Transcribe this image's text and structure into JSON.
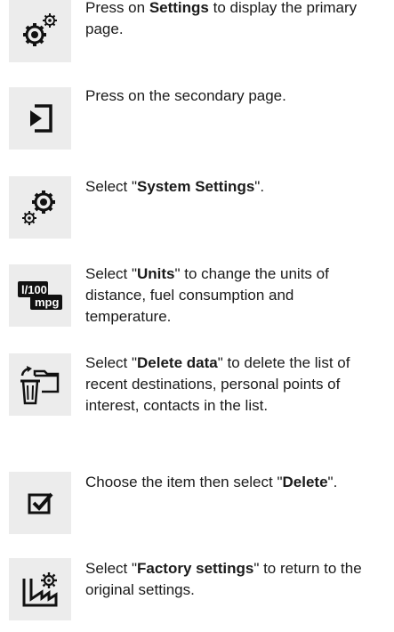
{
  "steps": [
    {
      "icon": "settings-gears-icon",
      "before": "Press on ",
      "bold": "Settings",
      "after": " to display the primary page."
    },
    {
      "icon": "secondary-page-icon",
      "before": "Press on the secondary page.",
      "bold": "",
      "after": ""
    },
    {
      "icon": "system-settings-icon",
      "before": "Select \"",
      "bold": "System Settings",
      "after": "\"."
    },
    {
      "icon": "units-icon",
      "icon_text_top": "l/100",
      "icon_text_bottom": "mpg",
      "before": "Select \"",
      "bold": "Units",
      "after": "\" to change the units of distance, fuel consumption and temperature."
    },
    {
      "icon": "delete-data-icon",
      "before": "Select \"",
      "bold": "Delete data",
      "after": "\" to delete the list of recent destinations, personal points of interest, contacts in the list."
    },
    {
      "icon": "checkbox-checked-icon",
      "before": "Choose the item then select \"",
      "bold": "Delete",
      "after": "\"."
    },
    {
      "icon": "factory-settings-icon",
      "before": "Select \"",
      "bold": "Factory settings",
      "after": "\" to return to the original settings."
    }
  ]
}
